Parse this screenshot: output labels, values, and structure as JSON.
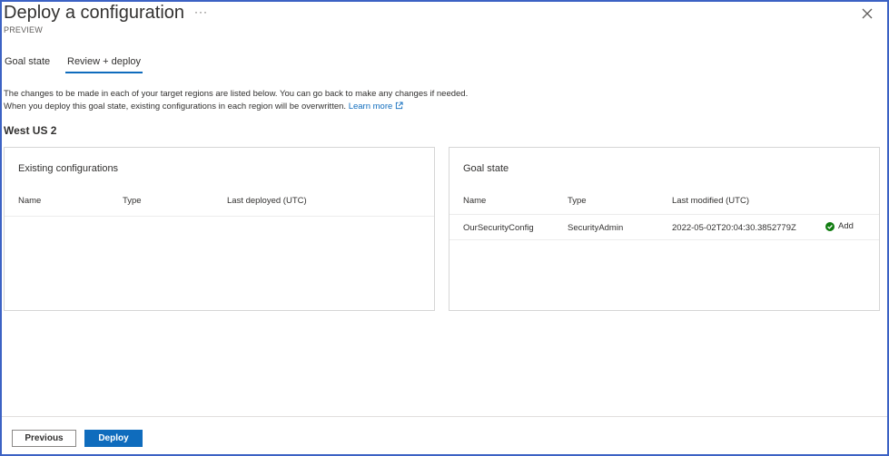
{
  "header": {
    "title": "Deploy a configuration",
    "more_label": "···",
    "subtitle": "PREVIEW"
  },
  "tabs": [
    {
      "label": "Goal state",
      "selected": false
    },
    {
      "label": "Review + deploy",
      "selected": true
    }
  ],
  "description": {
    "line1": "The changes to be made in each of your target regions are listed below. You can go back to make any changes if needed.",
    "line2": "When you deploy this goal state, existing configurations in each region will be overwritten.",
    "learn_more": "Learn more"
  },
  "region": "West US 2",
  "existing": {
    "title": "Existing configurations",
    "columns": [
      "Name",
      "Type",
      "Last deployed (UTC)"
    ],
    "rows": []
  },
  "goal": {
    "title": "Goal state",
    "columns": [
      "Name",
      "Type",
      "Last modified (UTC)"
    ],
    "rows": [
      {
        "name": "OurSecurityConfig",
        "type": "SecurityAdmin",
        "modified": "2022-05-02T20:04:30.3852779Z",
        "status": "Add"
      }
    ]
  },
  "footer": {
    "previous_label": "Previous",
    "deploy_label": "Deploy"
  },
  "colors": {
    "accent": "#0f6cbd",
    "success": "#107c10",
    "frame": "#3c62c4"
  }
}
